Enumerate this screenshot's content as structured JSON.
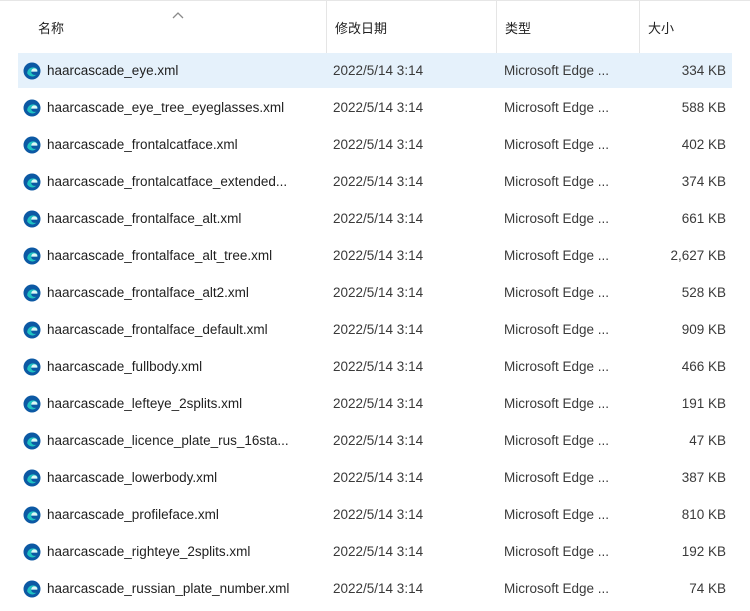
{
  "columns": {
    "name": "名称",
    "date_modified": "修改日期",
    "type": "类型",
    "size": "大小"
  },
  "sort": {
    "column": "name",
    "direction": "ascending",
    "icon": "chevron-up-icon"
  },
  "file_icon": "microsoft-edge-icon",
  "colors": {
    "selected_row": "#e5f1fb",
    "edge_blue": "#0c59a4",
    "edge_teal": "#1fc2c2"
  },
  "selected_index": 0,
  "files": [
    {
      "name": "haarcascade_eye.xml",
      "date": "2022/5/14 3:14",
      "type": "Microsoft Edge ...",
      "size": "334 KB"
    },
    {
      "name": "haarcascade_eye_tree_eyeglasses.xml",
      "date": "2022/5/14 3:14",
      "type": "Microsoft Edge ...",
      "size": "588 KB"
    },
    {
      "name": "haarcascade_frontalcatface.xml",
      "date": "2022/5/14 3:14",
      "type": "Microsoft Edge ...",
      "size": "402 KB"
    },
    {
      "name": "haarcascade_frontalcatface_extended...",
      "date": "2022/5/14 3:14",
      "type": "Microsoft Edge ...",
      "size": "374 KB"
    },
    {
      "name": "haarcascade_frontalface_alt.xml",
      "date": "2022/5/14 3:14",
      "type": "Microsoft Edge ...",
      "size": "661 KB"
    },
    {
      "name": "haarcascade_frontalface_alt_tree.xml",
      "date": "2022/5/14 3:14",
      "type": "Microsoft Edge ...",
      "size": "2,627 KB"
    },
    {
      "name": "haarcascade_frontalface_alt2.xml",
      "date": "2022/5/14 3:14",
      "type": "Microsoft Edge ...",
      "size": "528 KB"
    },
    {
      "name": "haarcascade_frontalface_default.xml",
      "date": "2022/5/14 3:14",
      "type": "Microsoft Edge ...",
      "size": "909 KB"
    },
    {
      "name": "haarcascade_fullbody.xml",
      "date": "2022/5/14 3:14",
      "type": "Microsoft Edge ...",
      "size": "466 KB"
    },
    {
      "name": "haarcascade_lefteye_2splits.xml",
      "date": "2022/5/14 3:14",
      "type": "Microsoft Edge ...",
      "size": "191 KB"
    },
    {
      "name": "haarcascade_licence_plate_rus_16sta...",
      "date": "2022/5/14 3:14",
      "type": "Microsoft Edge ...",
      "size": "47 KB"
    },
    {
      "name": "haarcascade_lowerbody.xml",
      "date": "2022/5/14 3:14",
      "type": "Microsoft Edge ...",
      "size": "387 KB"
    },
    {
      "name": "haarcascade_profileface.xml",
      "date": "2022/5/14 3:14",
      "type": "Microsoft Edge ...",
      "size": "810 KB"
    },
    {
      "name": "haarcascade_righteye_2splits.xml",
      "date": "2022/5/14 3:14",
      "type": "Microsoft Edge ...",
      "size": "192 KB"
    },
    {
      "name": "haarcascade_russian_plate_number.xml",
      "date": "2022/5/14 3:14",
      "type": "Microsoft Edge ...",
      "size": "74 KB"
    }
  ]
}
